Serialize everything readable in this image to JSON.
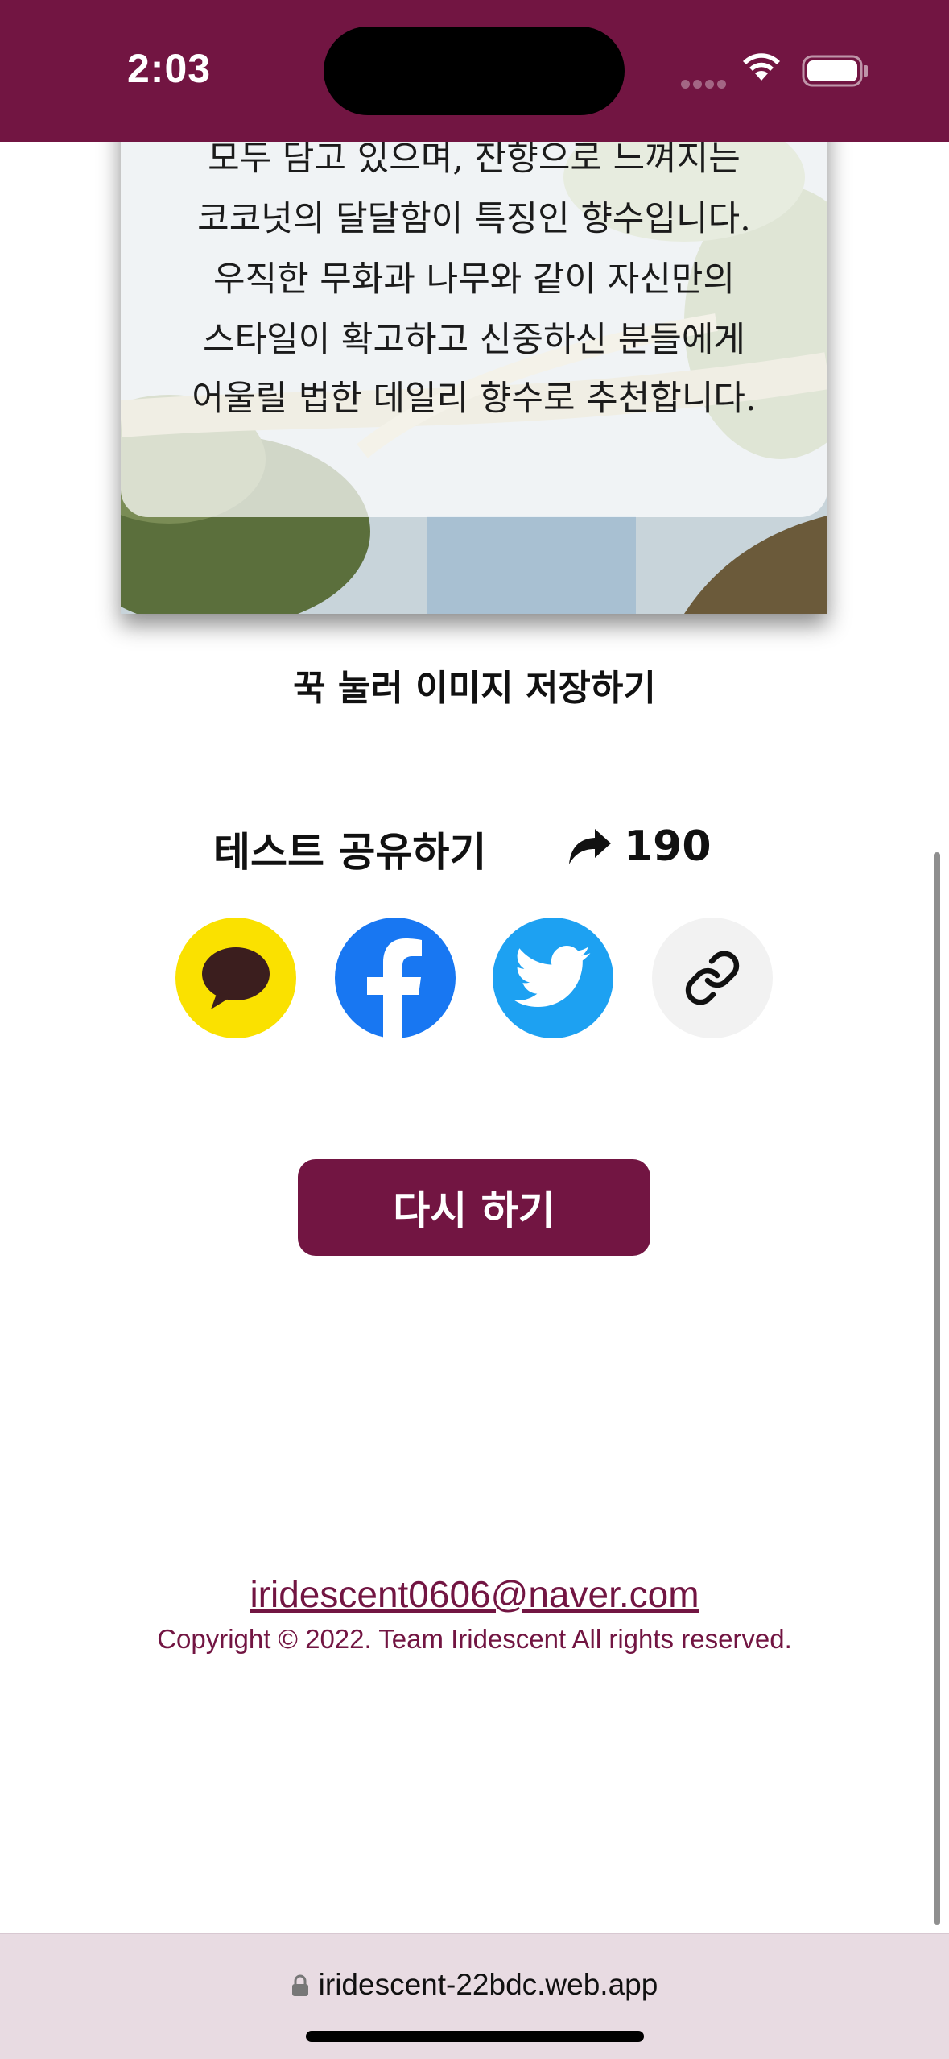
{
  "status_bar": {
    "time": "2:03"
  },
  "result_card": {
    "description_lines": [
      "모두 담고 있으며, 잔향으로 느껴지는",
      "코코넛의 달달함이 특징인 향수입니다.",
      "우직한 무화과 나무와 같이 자신만의",
      "스타일이 확고하고 신중하신 분들에게",
      "어울릴 법한 데일리 향수로 추천합니다."
    ]
  },
  "save_hint": "꾹 눌러 이미지 저장하기",
  "share": {
    "title": "테스트 공유하기",
    "count": "190",
    "buttons": [
      {
        "name": "kakao",
        "icon": "kakao-talk-icon",
        "color": "#fae100"
      },
      {
        "name": "facebook",
        "icon": "facebook-icon",
        "color": "#1877f2"
      },
      {
        "name": "twitter",
        "icon": "twitter-icon",
        "color": "#1da1f2"
      },
      {
        "name": "link",
        "icon": "link-icon",
        "color": "#f2f2f2"
      }
    ]
  },
  "retry_button": "다시 하기",
  "footer": {
    "email": "iridescent0606@naver.com",
    "copyright": "Copyright © 2022. Team Iridescent All rights reserved."
  },
  "browser": {
    "url": "iridescent-22bdc.web.app"
  },
  "colors": {
    "brand": "#721542",
    "url_bar": "#e8dbe2"
  }
}
